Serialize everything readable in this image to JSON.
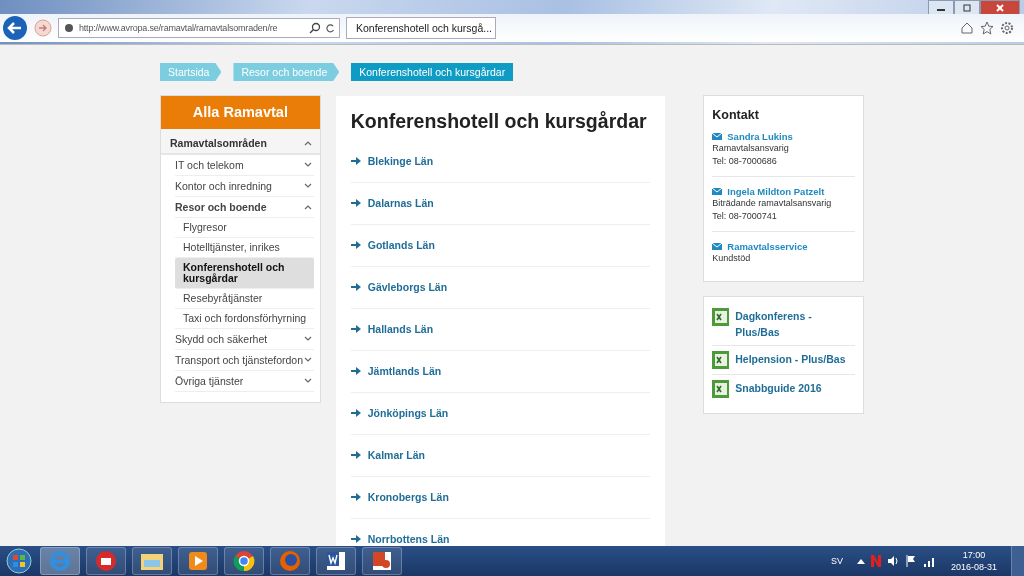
{
  "browser": {
    "address": "http://www.avropa.se/ramavtal/ramavtalsomraden/re",
    "tab_title": "Konferenshotell och kursgå..."
  },
  "breadcrumbs": [
    {
      "label": "Startsida",
      "selected": false
    },
    {
      "label": "Resor och boende",
      "selected": false
    },
    {
      "label": "Konferenshotell och kursgårdar",
      "selected": true
    }
  ],
  "sidebar": {
    "title": "Alla Ramavtal",
    "section": {
      "label": "Ramavtalsområden",
      "expanded": true
    },
    "items": [
      {
        "label": "IT och telekom",
        "expanded": false,
        "selected": false
      },
      {
        "label": "Kontor och inredning",
        "expanded": false,
        "selected": false
      },
      {
        "label": "Resor och boende",
        "expanded": true,
        "selected": false,
        "children": [
          {
            "label": "Flygresor",
            "selected": false
          },
          {
            "label": "Hotelltjänster, inrikes",
            "selected": false
          },
          {
            "label": "Konferenshotell och kursgårdar",
            "selected": true
          },
          {
            "label": "Resebyråtjänster",
            "selected": false
          },
          {
            "label": "Taxi och fordonsförhyrning",
            "selected": false
          }
        ]
      },
      {
        "label": "Skydd och säkerhet",
        "expanded": false,
        "selected": false
      },
      {
        "label": "Transport och tjänstefordon",
        "expanded": false,
        "selected": false
      },
      {
        "label": "Övriga tjänster",
        "expanded": false,
        "selected": false
      }
    ]
  },
  "main": {
    "title": "Konferenshotell och kursgårdar",
    "links": [
      "Blekinge Län",
      "Dalarnas Län",
      "Gotlands Län",
      "Gävleborgs Län",
      "Hallands Län",
      "Jämtlands Län",
      "Jönköpings Län",
      "Kalmar Län",
      "Kronobergs Län",
      "Norrbottens Län"
    ]
  },
  "contact": {
    "title": "Kontakt",
    "people": [
      {
        "name": "Sandra Lukins",
        "lines": [
          "Ramavtalsansvarig",
          "Tel: 08-7000686"
        ]
      },
      {
        "name": "Ingela Mildton Patzelt",
        "lines": [
          "Biträdande ramavtalsansvarig",
          "Tel: 08-7000741"
        ]
      },
      {
        "name": "Ramavtalsservice",
        "lines": [
          "Kundstöd"
        ]
      }
    ]
  },
  "documents": [
    "Dagkonferens - Plus/Bas",
    "Helpension - Plus/Bas",
    "Snabbguide 2016"
  ],
  "taskbar": {
    "language": "SV",
    "time": "17:00",
    "date": "2016-08-31"
  }
}
